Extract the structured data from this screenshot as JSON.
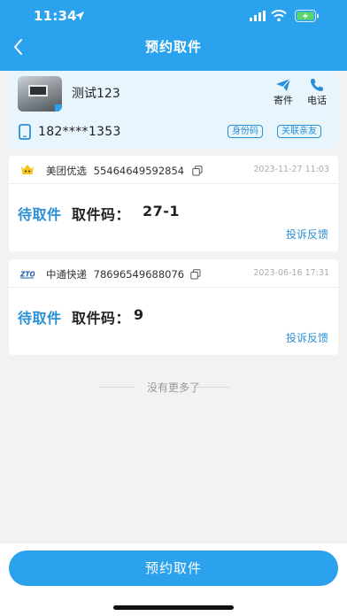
{
  "status_bar": {
    "time": "11:34"
  },
  "nav": {
    "title": "预约取件"
  },
  "user": {
    "name": "测试123",
    "phone": "182****1353",
    "send_label": "寄件",
    "call_label": "电话",
    "id_card_label": "身份码",
    "relatives_label": "关联亲友"
  },
  "packages": [
    {
      "company": "美团优选",
      "tracking_no": "55464649592854",
      "time": "2023-11-27 11:03",
      "status": "待取件",
      "code_label": "取件码：",
      "code": "27-1",
      "complaint": "投诉反馈"
    },
    {
      "company": "中通快递",
      "tracking_no": "78696549688076",
      "time": "2023-06-16 17:31",
      "status": "待取件",
      "code_label": "取件码：",
      "code": "9",
      "complaint": "投诉反馈"
    }
  ],
  "no_more": "没有更多了",
  "bottom_button": "预约取件",
  "colors": {
    "primary": "#2aa2ee",
    "link": "#2a8fd4",
    "card_bg": "#e8f5fd",
    "page_bg": "#f2f2f2"
  },
  "icons": {
    "back": "chevron-left-icon",
    "send": "paper-plane-icon",
    "call": "phone-icon",
    "phone": "mobile-phone-icon",
    "copy": "copy-icon",
    "meituan": "meituan-logo-icon",
    "zto": "zto-logo-icon"
  }
}
